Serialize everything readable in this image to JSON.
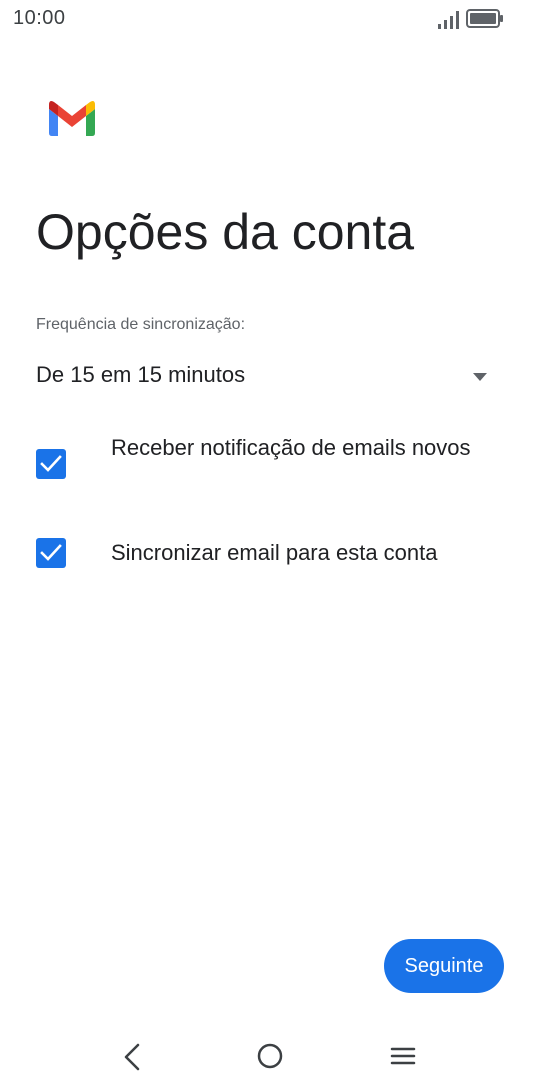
{
  "status_bar": {
    "time": "10:00",
    "signal_icon": "signal-icon",
    "battery_icon": "battery-icon"
  },
  "app": {
    "logo": "gmail-logo",
    "brand_colors": {
      "blue": "#4285F4",
      "red": "#EA4335",
      "yellow": "#FBBC04",
      "green": "#34A853",
      "dark_red": "#C5221F"
    }
  },
  "page": {
    "title": "Opções da conta"
  },
  "sync_frequency": {
    "label": "Frequência de sincronização:",
    "selected_value": "De 15 em 15 minutos",
    "icon": "dropdown-arrow-icon"
  },
  "options": [
    {
      "label": "Receber notificação de emails novos",
      "checked": true
    },
    {
      "label": "Sincronizar email para esta conta",
      "checked": true
    }
  ],
  "actions": {
    "next_label": "Seguinte"
  },
  "nav_bar": {
    "back_icon": "back-icon",
    "home_icon": "home-icon",
    "menu_icon": "menu-icon"
  },
  "colors": {
    "accent": "#1a73e8",
    "text_primary": "#202124",
    "text_secondary": "#5f6368"
  }
}
